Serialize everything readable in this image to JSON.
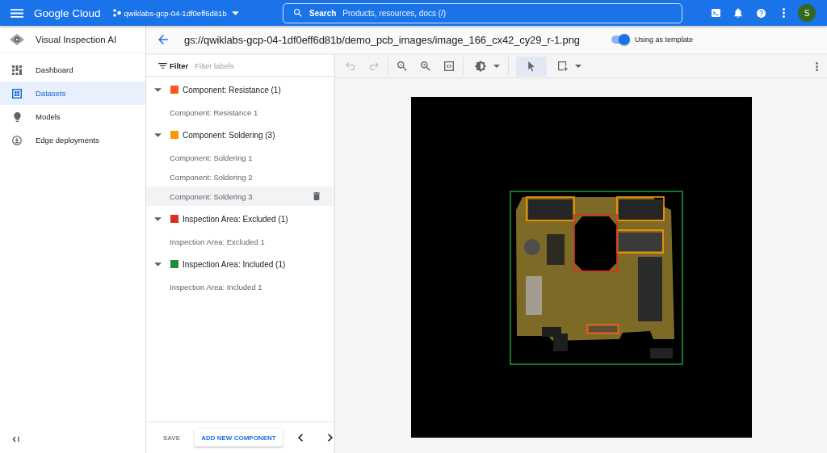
{
  "topbar": {
    "product": "Google Cloud",
    "project": "qwiklabs-gcp-04-1df0eff6d81b",
    "search": {
      "label": "Search",
      "placeholder": "Products, resources, docs (/)"
    },
    "avatar": "S"
  },
  "sidebar": {
    "title": "Visual Inspection AI",
    "items": [
      {
        "kind": "dashboard",
        "label": "Dashboard",
        "selected": false
      },
      {
        "kind": "datasets",
        "label": "Datasets",
        "selected": true
      },
      {
        "kind": "models",
        "label": "Models",
        "selected": false
      },
      {
        "kind": "edge",
        "label": "Edge deployments",
        "selected": false
      }
    ]
  },
  "header": {
    "path": "gs://qwiklabs-gcp-04-1df0eff6d81b/demo_pcb_images/image_166_cx42_cy29_r-1.png",
    "template_toggle": {
      "label": "Using as template",
      "on": true
    }
  },
  "labels_panel": {
    "filter": {
      "label": "Filter",
      "placeholder": "Filter labels"
    },
    "groups": [
      {
        "name": "Component: Resistance (1)",
        "color": "#ff5722",
        "expanded": true,
        "children": [
          {
            "label": "Component: Resistance 1",
            "selected": false
          }
        ]
      },
      {
        "name": "Component: Soldering (3)",
        "color": "#ff9800",
        "expanded": true,
        "children": [
          {
            "label": "Component: Soldering 1",
            "selected": false
          },
          {
            "label": "Component: Soldering 2",
            "selected": false
          },
          {
            "label": "Component: Soldering 3",
            "selected": true
          }
        ]
      },
      {
        "name": "Inspection Area: Excluded (1)",
        "color": "#d93025",
        "expanded": true,
        "children": [
          {
            "label": "Inspection Area: Excluded 1",
            "selected": false
          }
        ]
      },
      {
        "name": "Inspection Area: Included (1)",
        "color": "#1e8e3e",
        "expanded": true,
        "children": [
          {
            "label": "Inspection Area: Included 1",
            "selected": false
          }
        ]
      }
    ],
    "footer": {
      "save": {
        "label": "SAVE",
        "disabled": true
      },
      "add": "ADD NEW COMPONENT"
    }
  },
  "toolbar": {
    "action_groups": [
      {
        "tools": [
          {
            "kind": "undo",
            "disabled": true,
            "menu": false
          },
          {
            "kind": "redo",
            "disabled": true,
            "menu": false
          }
        ]
      },
      {
        "tools": [
          {
            "kind": "zoom-out",
            "disabled": false,
            "menu": false
          },
          {
            "kind": "zoom-in",
            "disabled": false,
            "menu": false
          },
          {
            "kind": "fit",
            "disabled": false,
            "menu": false
          }
        ]
      },
      {
        "tools": [
          {
            "kind": "brightness",
            "disabled": false,
            "menu": true
          }
        ]
      }
    ],
    "modes": [
      {
        "kind": "select",
        "selected": true,
        "menu": false
      },
      {
        "kind": "rectangle",
        "selected": false,
        "menu": true
      }
    ]
  }
}
